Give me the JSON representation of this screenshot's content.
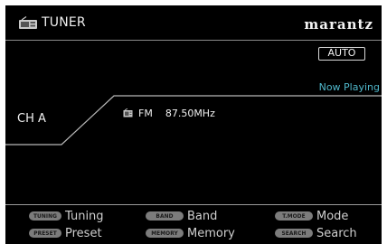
{
  "header": {
    "title": "TUNER",
    "brand": "marantz",
    "icon": "tuner-radio-icon"
  },
  "status": {
    "mode_badge": "AUTO",
    "now_playing": "Now Playing"
  },
  "channel": {
    "label": "CH A"
  },
  "station": {
    "band_icon": "band-icon",
    "band": "FM",
    "frequency": "87.50MHz"
  },
  "footer": {
    "buttons": [
      {
        "key": "TUNING",
        "label": "Tuning"
      },
      {
        "key": "BAND",
        "label": "Band"
      },
      {
        "key": "T.MODE",
        "label": "Mode"
      },
      {
        "key": "PRESET",
        "label": "Preset"
      },
      {
        "key": "MEMORY",
        "label": "Memory"
      },
      {
        "key": "SEARCH",
        "label": "Search"
      }
    ]
  },
  "colors": {
    "background": "#000000",
    "text": "#e6e6e6",
    "accent": "#4fb6c9",
    "pill": "#7c7c7c",
    "lines": "#8a8a8a"
  }
}
